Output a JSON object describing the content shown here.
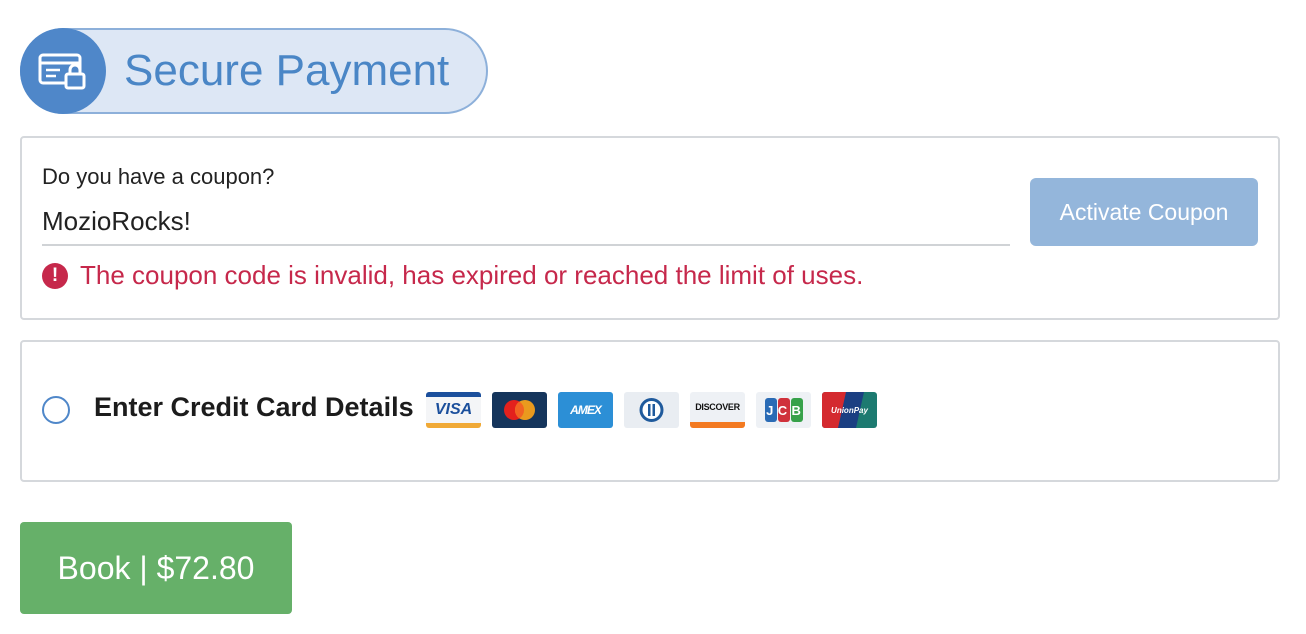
{
  "header": {
    "title": "Secure Payment",
    "icon": "credit-card-lock-icon"
  },
  "coupon": {
    "question": "Do you have a coupon?",
    "value": "MozioRocks!",
    "activate_label": "Activate Coupon",
    "error_message": "The coupon code is invalid, has expired or reached the limit of uses.",
    "error_icon": "!"
  },
  "payment": {
    "option_label": "Enter Credit Card Details",
    "cards": {
      "visa": "VISA",
      "amex": "AMEX",
      "discover": "DISCOVER",
      "unionpay": "UnionPay",
      "jcb_letters": [
        "J",
        "C",
        "B"
      ]
    }
  },
  "book": {
    "label": "Book | $72.80"
  },
  "colors": {
    "primary_blue": "#4f87c9",
    "error_red": "#c6284b",
    "book_green": "#66b069",
    "coupon_button": "#94b6db"
  }
}
